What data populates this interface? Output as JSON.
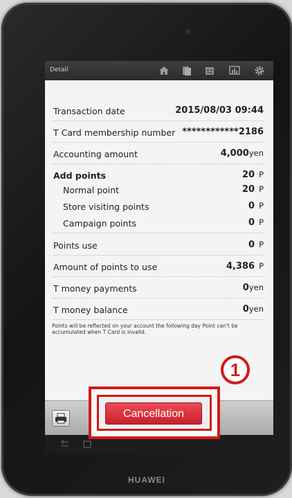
{
  "device": {
    "brand": "HUAWEI"
  },
  "statusbar": {
    "title": "Detail",
    "icons": [
      "home-icon",
      "document-icon",
      "grid-icon",
      "chart-icon",
      "gear-icon"
    ]
  },
  "rows": {
    "transaction_date": {
      "label": "Transaction date",
      "value": "2015/08/03 09:44"
    },
    "membership_number": {
      "label": "T Card membership number",
      "value": "************2186"
    },
    "accounting_amount": {
      "label": "Accounting amount",
      "value": "4,000",
      "unit": "yen"
    },
    "add_points": {
      "label": "Add points",
      "value": "20",
      "unit": "P"
    },
    "normal_point": {
      "label": "Normal point",
      "value": "20",
      "unit": "P"
    },
    "store_visiting_points": {
      "label": "Store visiting points",
      "value": "0",
      "unit": "P"
    },
    "campaign_points": {
      "label": "Campaign points",
      "value": "0",
      "unit": "P"
    },
    "points_use": {
      "label": "Points use",
      "value": "0",
      "unit": "P"
    },
    "amount_points_to_use": {
      "label": "Amount of points to use",
      "value": "4,386",
      "unit": "P"
    },
    "t_money_payments": {
      "label": "T money payments",
      "value": "0",
      "unit": "yen"
    },
    "t_money_balance": {
      "label": "T money balance",
      "value": "0",
      "unit": "yen"
    }
  },
  "note": "Points will be reflected on your account the following day Point can't be accumulated when T Card is invalid.",
  "actions": {
    "cancel_label": "Cancellation"
  },
  "annotation": {
    "step_number": "1"
  },
  "colors": {
    "highlight": "#d11a1a",
    "cancel_button": "#d8323c"
  }
}
